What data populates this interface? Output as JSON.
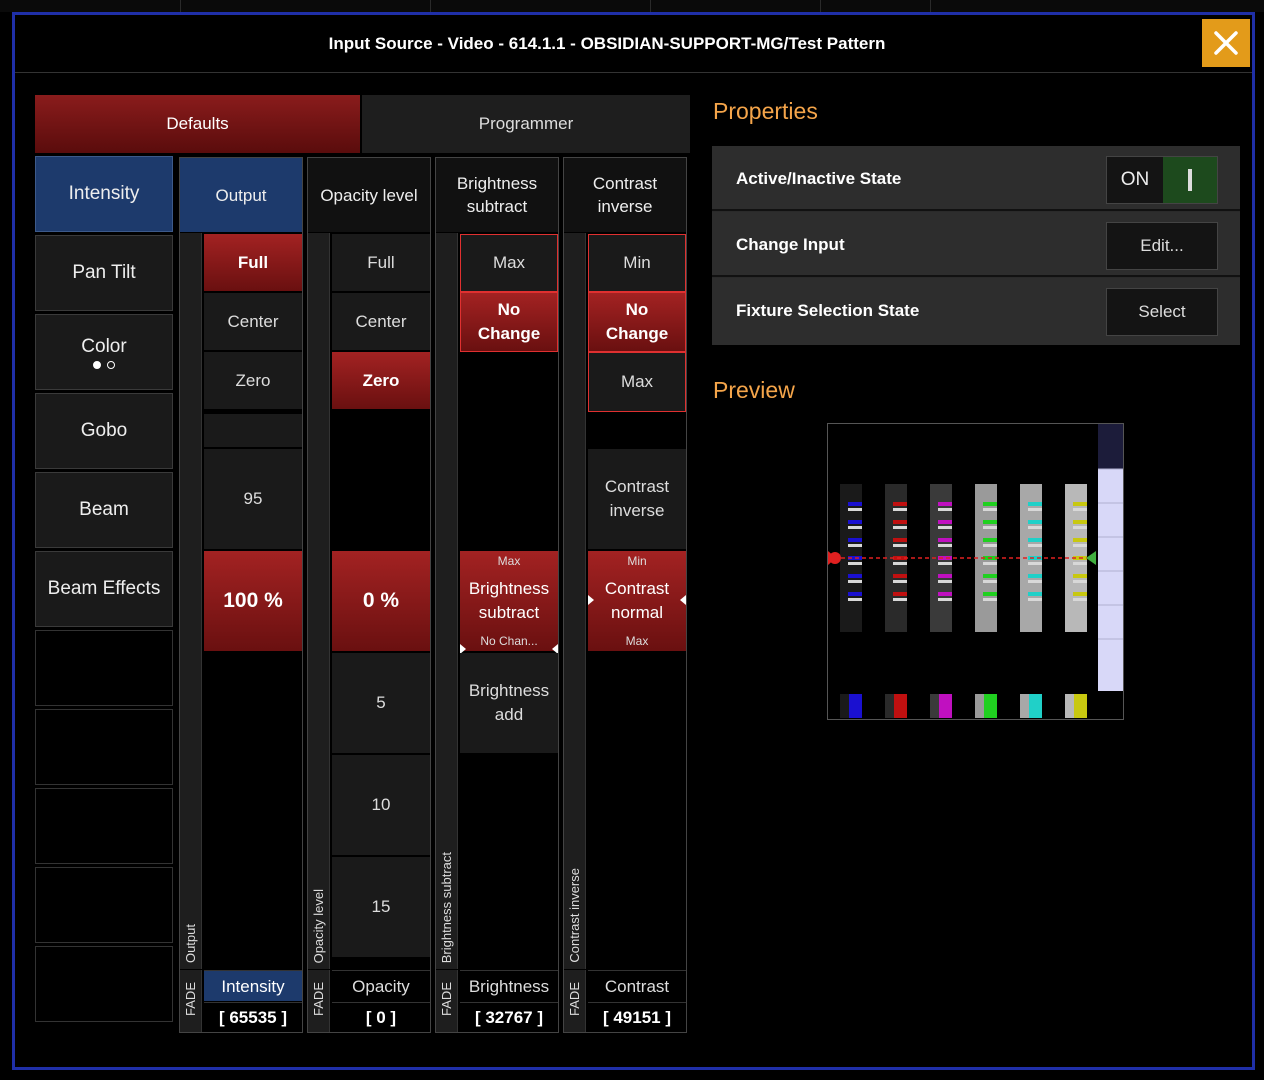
{
  "window": {
    "title": "Input Source - Video - 614.1.1 - OBSIDIAN-SUPPORT-MG/Test Pattern"
  },
  "tabs": {
    "defaults": "Defaults",
    "programmer": "Programmer"
  },
  "categories": {
    "intensity": "Intensity",
    "pan_tilt": "Pan Tilt",
    "color": "Color",
    "gobo": "Gobo",
    "beam": "Beam",
    "beam_effects": "Beam Effects"
  },
  "columns": {
    "output": {
      "header": "Output",
      "strip_label": "Output",
      "full": "Full",
      "center": "Center",
      "zero": "Zero",
      "tick": "95",
      "value": "100 %",
      "fade": "FADE",
      "param": "Intensity",
      "dmx": "[ 65535 ]"
    },
    "opacity": {
      "header": "Opacity level",
      "strip_label": "Opacity level",
      "full": "Full",
      "center": "Center",
      "zero": "Zero",
      "value": "0 %",
      "tick1": "5",
      "tick2": "10",
      "tick3": "15",
      "fade": "FADE",
      "param": "Opacity",
      "dmx": "[ 0 ]"
    },
    "brightness": {
      "header_line1": "Brightness",
      "header_line2": "subtract",
      "strip_label": "Brightness subtract",
      "max": "Max",
      "no_change_1": "No",
      "no_change_2": "Change",
      "slot_top": "Max",
      "slot_mid_1": "Brightness",
      "slot_mid_2": "subtract",
      "slot_bottom": "No Chan...",
      "add_1": "Brightness",
      "add_2": "add",
      "fade": "FADE",
      "param": "Brightness",
      "dmx": "[ 32767 ]"
    },
    "contrast": {
      "header_line1": "Contrast",
      "header_line2": "inverse",
      "strip_label": "Contrast inverse",
      "min": "Min",
      "no_change_1": "No",
      "no_change_2": "Change",
      "max": "Max",
      "inverse_1": "Contrast",
      "inverse_2": "inverse",
      "slot_top": "Min",
      "slot_mid_1": "Contrast",
      "slot_mid_2": "normal",
      "slot_bottom": "Max",
      "fade": "FADE",
      "param": "Contrast",
      "dmx": "[ 49151 ]"
    }
  },
  "properties": {
    "title": "Properties",
    "active_state": {
      "label": "Active/Inactive State",
      "value": "ON"
    },
    "change_input": {
      "label": "Change Input",
      "button": "Edit..."
    },
    "fixture_selection": {
      "label": "Fixture Selection State",
      "button": "Select"
    }
  },
  "preview": {
    "title": "Preview",
    "bar_colors": [
      "#1a10d0",
      "#c01010",
      "#c010c0",
      "#20d020",
      "#20d0c8",
      "#c8c810"
    ]
  }
}
